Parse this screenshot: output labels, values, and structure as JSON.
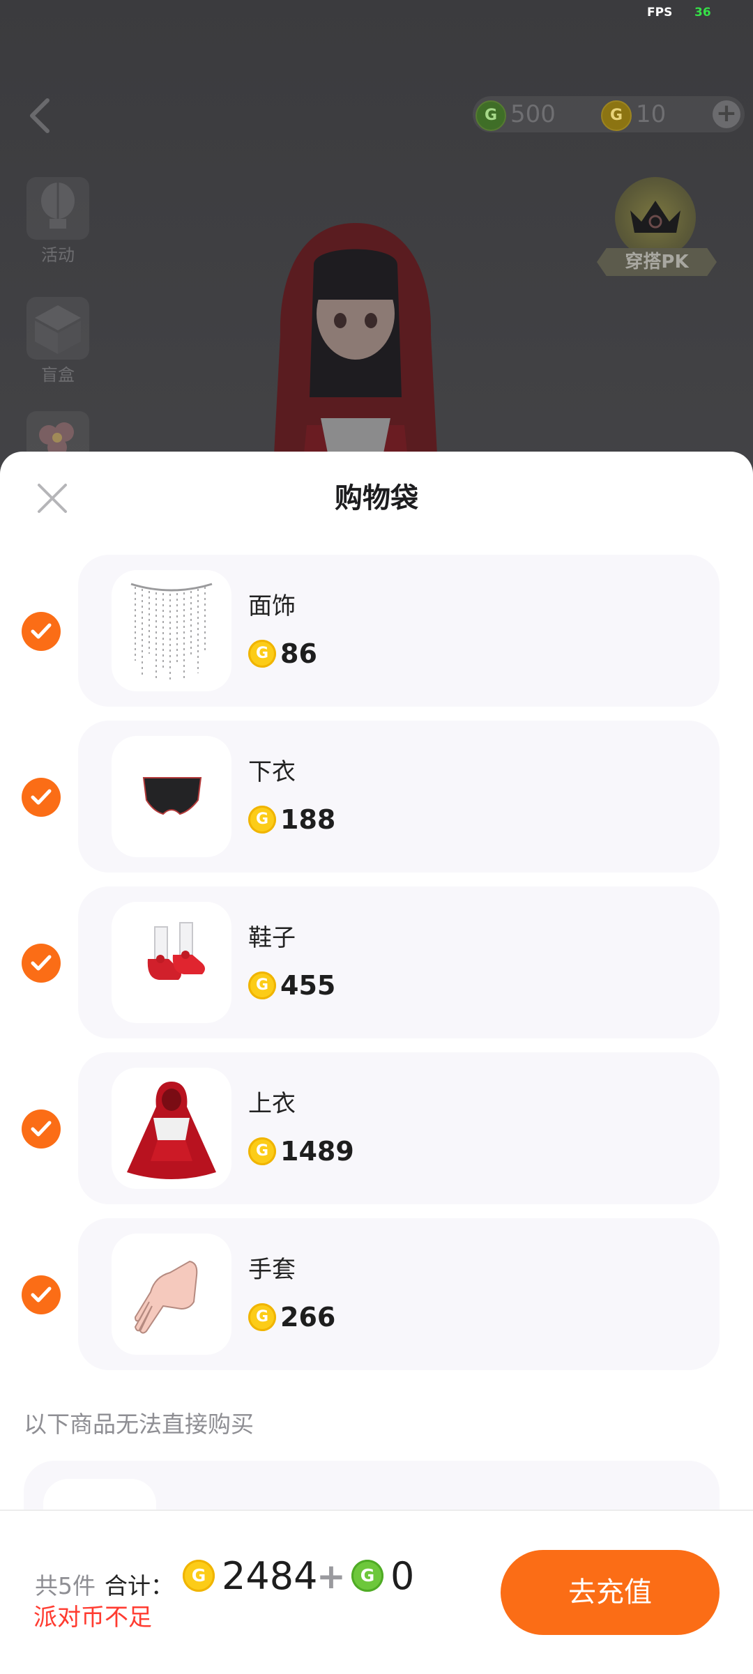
{
  "status": {
    "fps_label": "FPS",
    "fps_value": "36"
  },
  "topbar": {
    "green_coin_balance": "500",
    "gold_coin_balance": "10",
    "add_label": "+"
  },
  "side_menu": [
    {
      "label": "活动",
      "icon": "balloon-icon"
    },
    {
      "label": "盲盒",
      "icon": "gift-box-icon"
    },
    {
      "label": "",
      "icon": "flower-icon"
    }
  ],
  "pk_badge": {
    "label": "穿搭PK"
  },
  "sheet": {
    "title": "购物袋",
    "items": [
      {
        "name": "面饰",
        "price": "86",
        "checked": true,
        "thumb": "face-veil"
      },
      {
        "name": "下衣",
        "price": "188",
        "checked": true,
        "thumb": "shorts"
      },
      {
        "name": "鞋子",
        "price": "455",
        "checked": true,
        "thumb": "red-shoes"
      },
      {
        "name": "上衣",
        "price": "1489",
        "checked": true,
        "thumb": "red-cape"
      },
      {
        "name": "手套",
        "price": "266",
        "checked": true,
        "thumb": "hand"
      }
    ],
    "unavailable_notice": "以下商品无法直接购买"
  },
  "footer": {
    "count_text": "共5件",
    "total_label": "合计：",
    "total_gold": "2484",
    "plus": "+",
    "total_green": "0",
    "warning": "派对币不足",
    "recharge_label": "去充值"
  },
  "colors": {
    "accent": "#fb6d16",
    "gold_coin": "#fccc18",
    "green_coin": "#6dc73b",
    "warning": "#ff3b30"
  }
}
